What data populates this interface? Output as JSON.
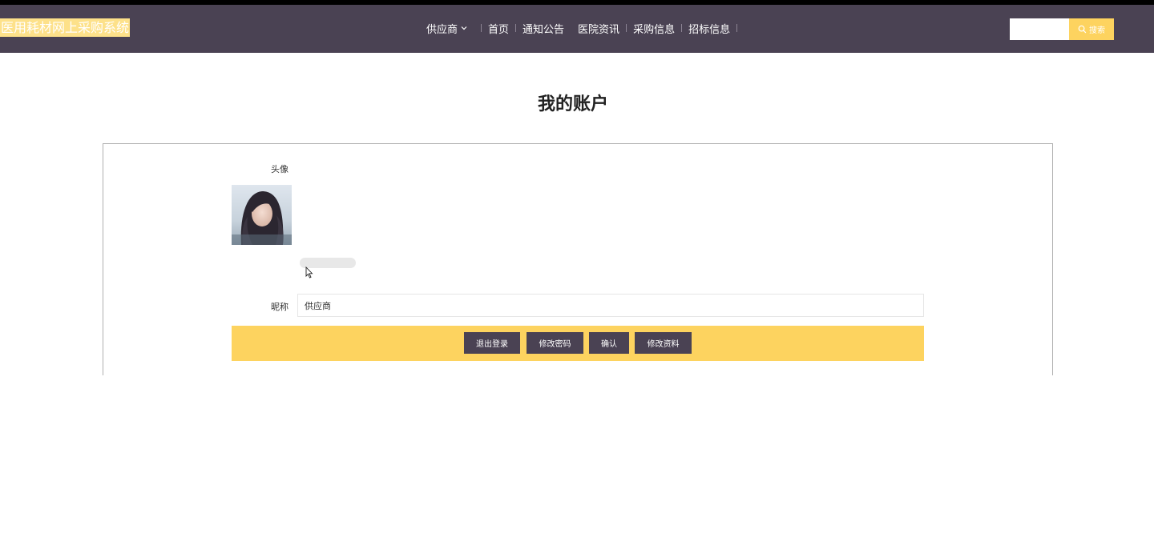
{
  "header": {
    "brand": "医用耗材网上采购系统",
    "nav": [
      {
        "label": "供应商",
        "has_dropdown": true
      },
      {
        "label": "首页"
      },
      {
        "label": "通知公告"
      },
      {
        "label": "医院资讯"
      },
      {
        "label": "采购信息"
      },
      {
        "label": "招标信息"
      }
    ],
    "search": {
      "placeholder": "",
      "button_label": "搜索"
    }
  },
  "page": {
    "title": "我的账户"
  },
  "form": {
    "avatar_label": "头像",
    "nickname_label": "昵称",
    "nickname_value": "供应商"
  },
  "actions": {
    "logout": "退出登录",
    "change_password": "修改密码",
    "confirm": "确认",
    "edit_profile": "修改资料"
  },
  "colors": {
    "navbar": "#4a4253",
    "accent": "#fdd35f",
    "button": "#4a4253"
  }
}
